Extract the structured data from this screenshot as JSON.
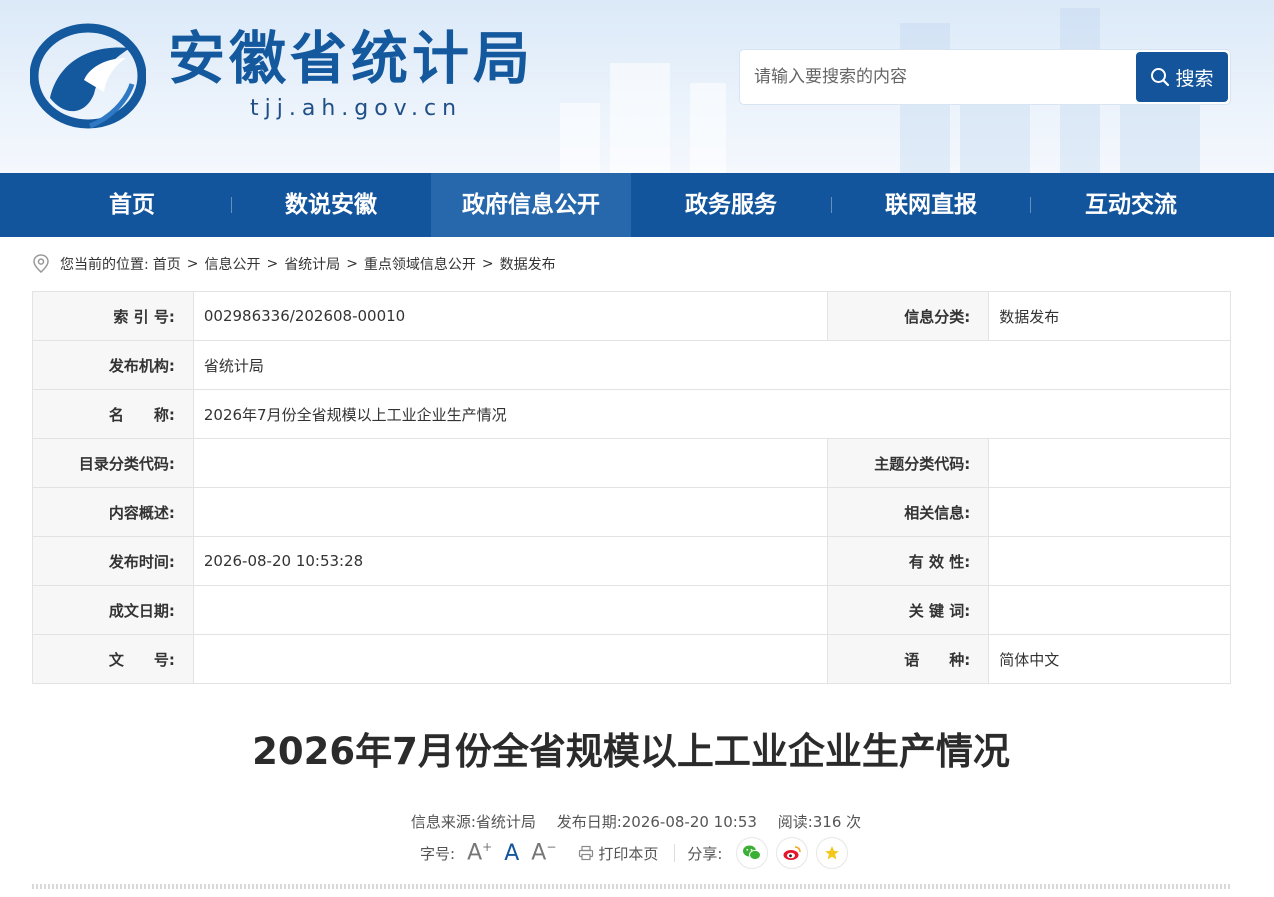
{
  "header": {
    "site_title": "安徽省统计局",
    "site_domain": "tjj.ah.gov.cn",
    "search_placeholder": "请输入要搜索的内容",
    "search_button": "搜索",
    "brand_color": "#13559c"
  },
  "nav": {
    "items": [
      {
        "label": "首页"
      },
      {
        "label": "数说安徽"
      },
      {
        "label": "政府信息公开",
        "active": true
      },
      {
        "label": "政务服务"
      },
      {
        "label": "联网直报"
      },
      {
        "label": "互动交流"
      }
    ]
  },
  "breadcrumb": {
    "prefix": "您当前的位置:",
    "items": [
      "首页",
      "信息公开",
      "省统计局",
      "重点领域信息公开",
      "数据发布"
    ],
    "separator": ">"
  },
  "info": {
    "index_label": "索 引 号:",
    "index_value": "002986336/202608-00010",
    "category_label": "信息分类:",
    "category_value": "数据发布",
    "publisher_label": "发布机构:",
    "publisher_value": "省统计局",
    "name_label": "名　　称:",
    "name_value": "2026年7月份全省规模以上工业企业生产情况",
    "catalog_code_label": "目录分类代码:",
    "catalog_code_value": "",
    "topic_code_label": "主题分类代码:",
    "topic_code_value": "",
    "summary_label": "内容概述:",
    "summary_value": "",
    "related_label": "相关信息:",
    "related_value": "",
    "publish_time_label": "发布时间:",
    "publish_time_value": "2026-08-20 10:53:28",
    "validity_label": "有 效 性:",
    "validity_value": "",
    "written_date_label": "成文日期:",
    "written_date_value": "",
    "keywords_label": "关 键 词:",
    "keywords_value": "",
    "doc_no_label": "文　　号:",
    "doc_no_value": "",
    "language_label": "语　　种:",
    "language_value": "简体中文"
  },
  "article": {
    "title": "2026年7月份全省规模以上工业企业生产情况",
    "source": "信息来源:省统计局",
    "date": "发布日期:2026-08-20 10:53",
    "views": "阅读:316 次",
    "font_size_label": "字号:",
    "print_label": "打印本页",
    "share_label": "分享:"
  }
}
